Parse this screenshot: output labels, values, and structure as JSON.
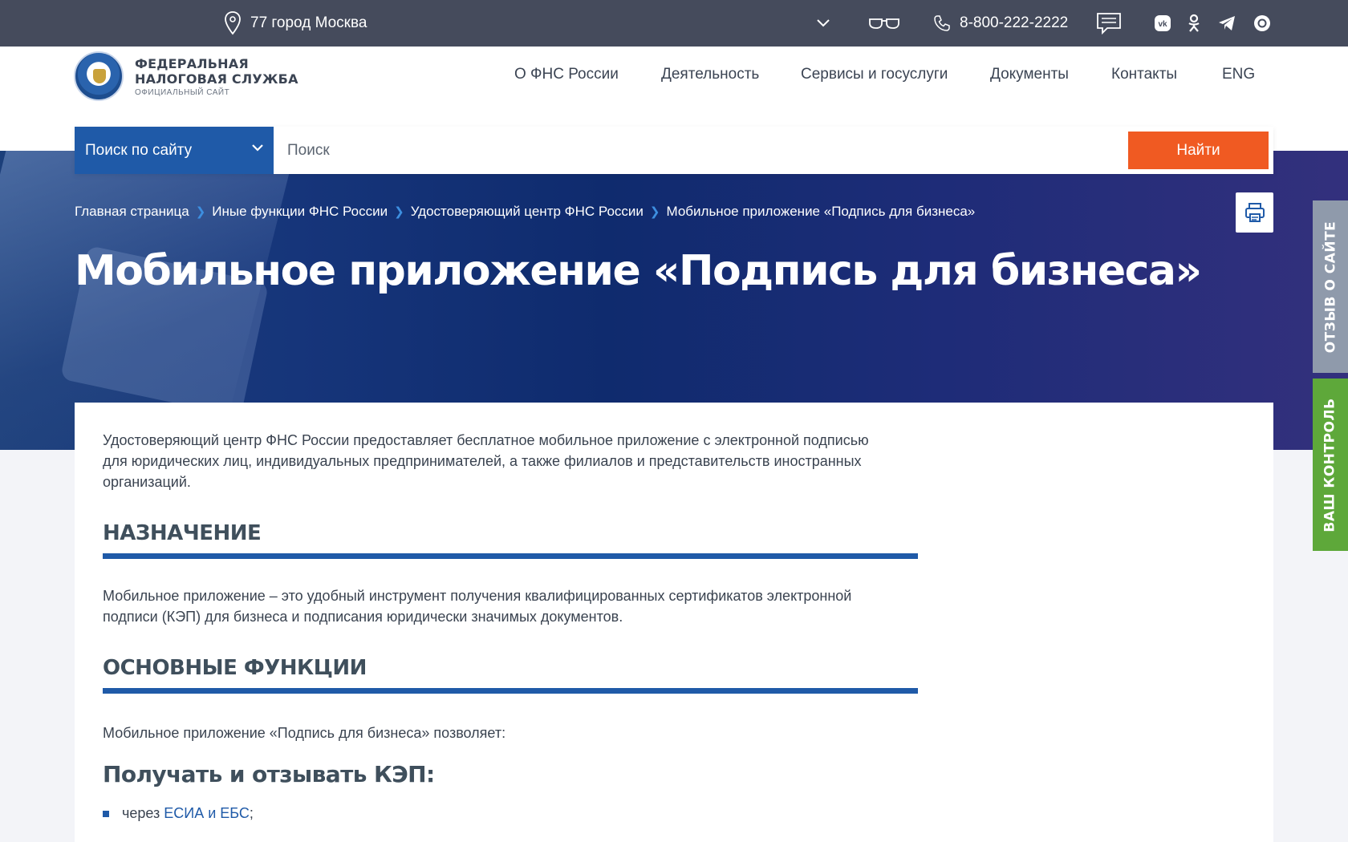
{
  "topbar": {
    "location": "77 город Москва",
    "phone": "8-800-222-2222",
    "icons": [
      "location-pin-icon",
      "chevron-down-icon",
      "glasses-icon",
      "phone-icon",
      "chat-icon",
      "vk-icon",
      "odnoklassniki-icon",
      "telegram-icon",
      "max-icon"
    ]
  },
  "logo": {
    "line1": "ФЕДЕРАЛЬНАЯ",
    "line2": "НАЛОГОВАЯ СЛУЖБА",
    "line3": "ОФИЦИАЛЬНЫЙ САЙТ"
  },
  "nav": {
    "items": [
      "О ФНС России",
      "Деятельность",
      "Сервисы и госуслуги",
      "Документы",
      "Контакты",
      "ENG"
    ]
  },
  "search": {
    "scope": "Поиск по сайту",
    "placeholder": "Поиск",
    "button": "Найти"
  },
  "breadcrumb": [
    "Главная страница",
    "Иные функции ФНС России",
    "Удостоверяющий центр ФНС России",
    "Мобильное приложение «Подпись для бизнеса»"
  ],
  "page": {
    "title": "Мобильное приложение «Подпись для бизнеса»"
  },
  "content": {
    "intro_line1": "Удостоверяющий центр ФНС России предоставляет бесплатное мобильное приложение с электронной подписью",
    "intro_line2": "для юридических лиц, индивидуальных предпринимателей, а также филиалов и представительств иностранных",
    "intro_line3": "организаций.",
    "h_purpose": "НАЗНАЧЕНИЕ",
    "purpose_line1": "Мобильное приложение – это удобный инструмент получения квалифицированных сертификатов электронной",
    "purpose_line2": "подписи (КЭП) для бизнеса и подписания юридически значимых документов.",
    "h_functions": "ОСНОВНЫЕ ФУНКЦИИ",
    "functions_intro": "Мобильное приложение «Подпись для бизнеса» позволяет:",
    "h_get": "Получать и отзывать КЭП:",
    "li1_prefix": "через",
    "li1_link": "ЕСИА и ЕБС",
    "li1_suffix": ";"
  },
  "side_tabs": {
    "feedback": "ОТЗЫВ О САЙТЕ",
    "control": "ВАШ КОНТРОЛЬ"
  },
  "colors": {
    "topbar": "#454b5c",
    "brand_blue": "#1f5aa8",
    "search_button": "#f05a22",
    "feedback_tab": "#8f9aab",
    "control_tab": "#5ea83a"
  }
}
